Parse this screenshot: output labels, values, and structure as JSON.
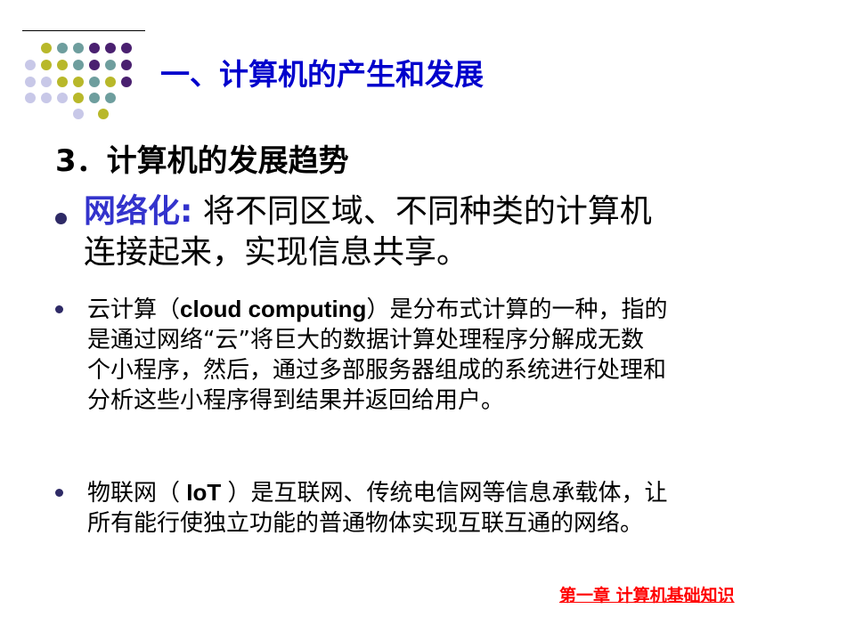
{
  "slide": {
    "title": "一、计算机的产生和发展",
    "subtitle": "3．计算机的发展趋势",
    "bullet1": {
      "keyword": "网络化:",
      "text_line1": "将不同区域、不同种类的计算机",
      "text_line2": "连接起来，实现信息共享。"
    },
    "bullet2": {
      "prefix": "云计算（",
      "term": "cloud computing",
      "suffix_line1": "）是分布式计算的一种，指的",
      "line2": "是通过网络“云”将巨大的数据计算处理程序分解成无数",
      "line3": "个小程序，然后，通过多部服务器组成的系统进行处理和",
      "line4": "分析这些小程序得到结果并返回给用户。"
    },
    "bullet3": {
      "prefix": "物联网（",
      "term": " IoT ",
      "suffix_line1": "）是互联网、传统电信网等信息承载体，让",
      "line2": "所有能行使独立功能的普通物体实现互联互通的网络。"
    },
    "footer": "第一章 计算机基础知识"
  },
  "colors": {
    "title": "#0000cc",
    "keyword": "#3333cc",
    "footer": "#ff0000",
    "bullet": "#2e2a66",
    "dot_olive": "#b8b82a",
    "dot_teal": "#6e9e9e",
    "dot_purple": "#4a2070",
    "dot_lavender": "#c8c8e8"
  },
  "icons": {
    "decoration": "dot-grid-icon",
    "bullet": "bullet-dot-icon"
  }
}
